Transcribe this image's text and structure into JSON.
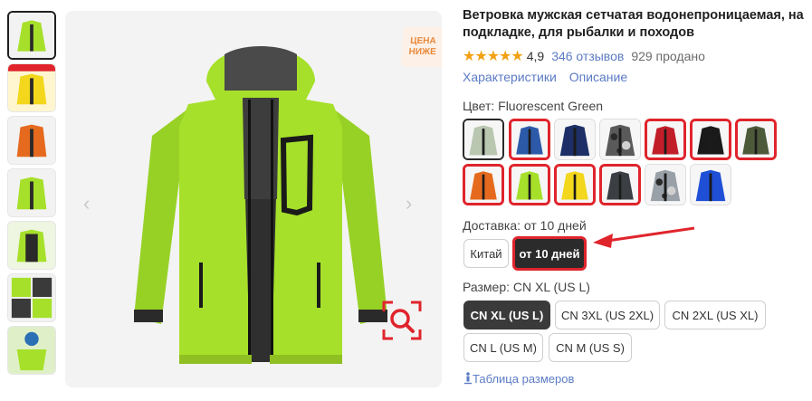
{
  "product": {
    "title": "Ветровка мужская сетчатая водонепроницаемая, на подкладке, для рыбалки и походов",
    "stars": "★★★★★",
    "rating": "4,9",
    "reviews": "346 отзывов",
    "sold": "929 продано",
    "links": [
      "Характеристики",
      "Описание"
    ]
  },
  "badge": {
    "line1": "ЦЕНА",
    "line2": "НИЖЕ"
  },
  "nav": {
    "prev": "‹",
    "next": "›"
  },
  "color": {
    "label": "Цвет: Fluorescent Green",
    "swatches": [
      {
        "name": "light-grey",
        "color": "#b9c6b0"
      },
      {
        "name": "blue",
        "color": "#2c5aa8"
      },
      {
        "name": "navy",
        "color": "#1d2f66"
      },
      {
        "name": "camo-grey",
        "color": "#5a5a5a"
      },
      {
        "name": "red",
        "color": "#c11e2a"
      },
      {
        "name": "black",
        "color": "#1a1a1a"
      },
      {
        "name": "army-green",
        "color": "#4d5a3a"
      },
      {
        "name": "orange",
        "color": "#e56a1e"
      },
      {
        "name": "fluorescent-green",
        "color": "#a6e02a"
      },
      {
        "name": "yellow",
        "color": "#f2d71c"
      },
      {
        "name": "dark-grey",
        "color": "#3b3f44"
      },
      {
        "name": "camo-white",
        "color": "#9aa0a8"
      },
      {
        "name": "royal-blue",
        "color": "#1e4fd6"
      }
    ]
  },
  "delivery": {
    "label": "Доставка: от 10 дней",
    "options": [
      "Китай",
      "от 10 дней"
    ]
  },
  "size": {
    "label": "Размер: CN XL (US L)",
    "options": [
      "CN XL (US L)",
      "CN 3XL (US 2XL)",
      "CN 2XL (US XL)",
      "CN L (US M)",
      "CN M (US S)"
    ],
    "table_link": "Таблица размеров",
    "table_icon": "ruler-person-icon"
  },
  "accent": "#e0242c",
  "link_color": "#5b7bc4",
  "jacket_color": "#a6e02a"
}
